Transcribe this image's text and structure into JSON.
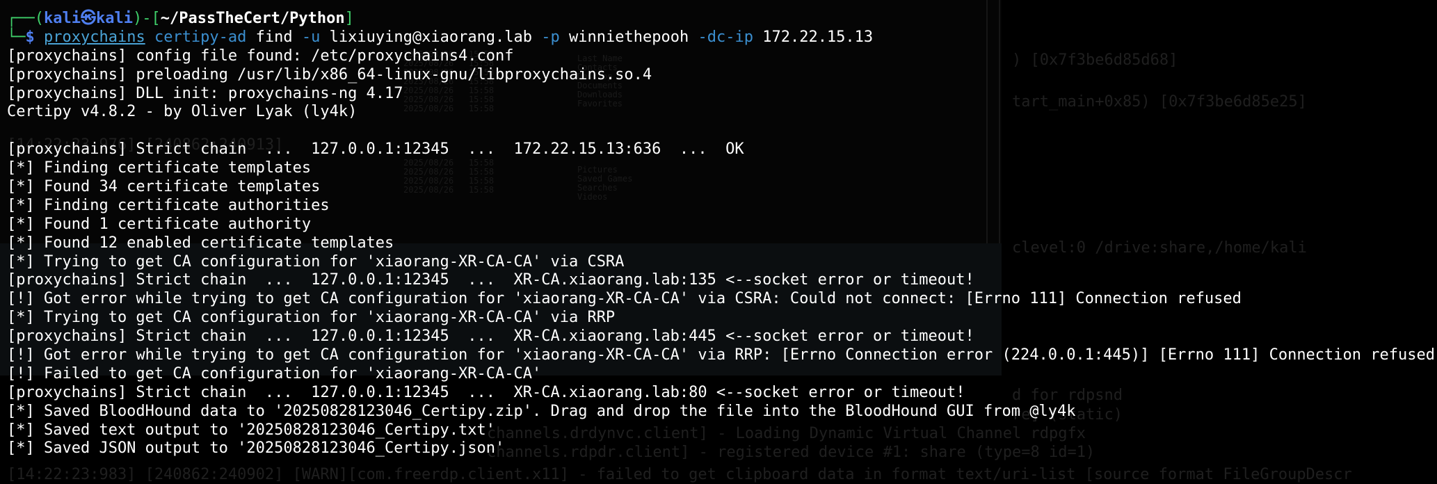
{
  "prompt": {
    "box_top": "┌──(",
    "user": "kali",
    "at": "㉿",
    "host": "kali",
    "mid": ")-[",
    "path": "~/PassTheCert/Python",
    "close": "]",
    "box_bottom": "└─",
    "dollar": "$"
  },
  "command": {
    "program": "proxychains",
    "tool": "certipy-ad",
    "subcommand": "find",
    "flag_u": "-u",
    "user": "lixiuying@xiaorang.lab",
    "flag_p": "-p",
    "password": "winniethepooh",
    "flag_dcip": "-dc-ip",
    "dcip": "172.22.15.13"
  },
  "output": [
    "[proxychains] config file found: /etc/proxychains4.conf",
    "[proxychains] preloading /usr/lib/x86_64-linux-gnu/libproxychains.so.4",
    "[proxychains] DLL init: proxychains-ng 4.17",
    "Certipy v4.8.2 - by Oliver Lyak (ly4k)",
    "",
    "[proxychains] Strict chain  ...  127.0.0.1:12345  ...  172.22.15.13:636  ...  OK",
    "[*] Finding certificate templates",
    "[*] Found 34 certificate templates",
    "[*] Finding certificate authorities",
    "[*] Found 1 certificate authority",
    "[*] Found 12 enabled certificate templates",
    "[*] Trying to get CA configuration for 'xiaorang-XR-CA-CA' via CSRA",
    "[proxychains] Strict chain  ...  127.0.0.1:12345  ...  XR-CA.xiaorang.lab:135 <--socket error or timeout!",
    "[!] Got error while trying to get CA configuration for 'xiaorang-XR-CA-CA' via CSRA: Could not connect: [Errno 111] Connection refused",
    "[*] Trying to get CA configuration for 'xiaorang-XR-CA-CA' via RRP",
    "[proxychains] Strict chain  ...  127.0.0.1:12345  ...  XR-CA.xiaorang.lab:445 <--socket error or timeout!",
    "[!] Got error while trying to get CA configuration for 'xiaorang-XR-CA-CA' via RRP: [Errno Connection error (224.0.0.1:445)] [Errno 111] Connection refused",
    "[!] Failed to get CA configuration for 'xiaorang-XR-CA-CA'",
    "[proxychains] Strict chain  ...  127.0.0.1:12345  ...  XR-CA.xiaorang.lab:80 <--socket error or timeout!",
    "[*] Saved BloodHound data to '20250828123046_Certipy.zip'. Drag and drop the file into the BloodHound GUI from @ly4k",
    "[*] Saved text output to '20250828123046_Certipy.txt'",
    "[*] Saved JSON output to '20250828123046_Certipy.json'"
  ],
  "colors": {
    "background": "#000000",
    "prompt_frame": "#3fd06a",
    "prompt_user": "#4f7ff0",
    "command_program": "#4aa3d6",
    "command_tool": "#3b8fd0",
    "text": "#ffffff"
  }
}
